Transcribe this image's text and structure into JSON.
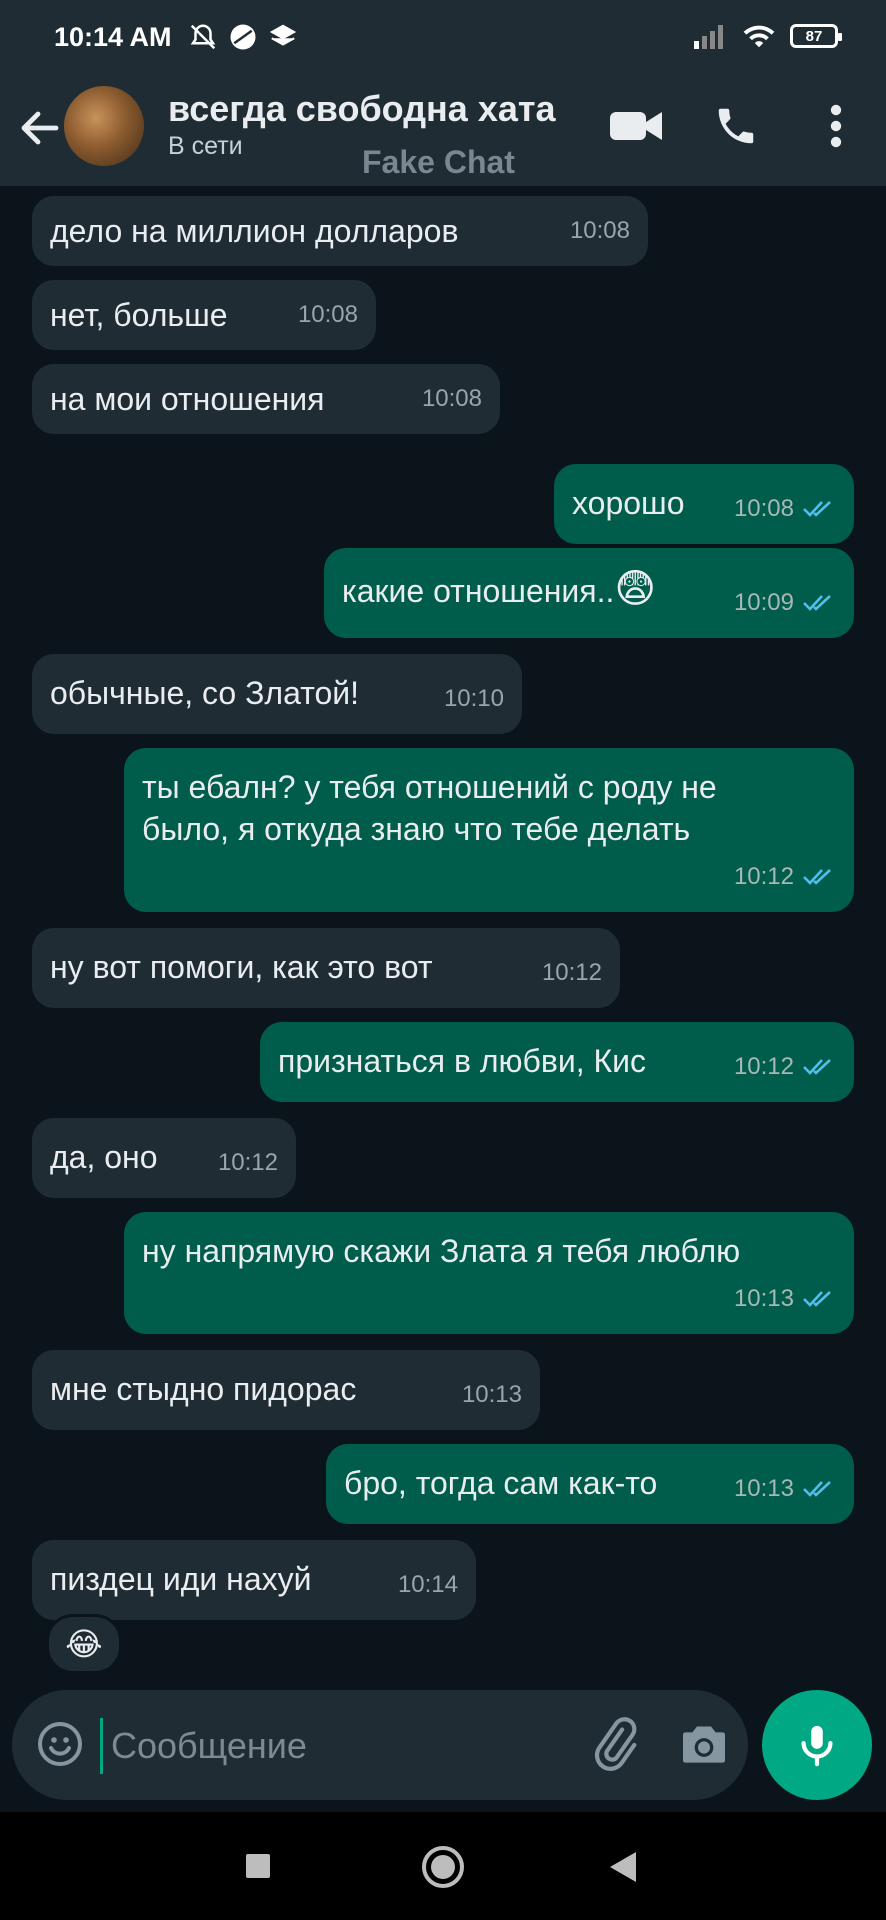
{
  "status_bar": {
    "time": "10:14 AM",
    "battery": "87"
  },
  "header": {
    "title": "всегда свободна хата",
    "status": "В сети",
    "watermark": "Fake Chat",
    "icons": [
      "back-arrow-icon",
      "avatar",
      "video-call-icon",
      "phone-icon",
      "more-vert-icon"
    ]
  },
  "messages": [
    {
      "dir": "in",
      "text": "дело на миллион долларов",
      "time": "10:08"
    },
    {
      "dir": "in",
      "text": "нет, больше",
      "time": "10:08"
    },
    {
      "dir": "in",
      "text": "на мои отношения",
      "time": "10:08"
    },
    {
      "dir": "out",
      "text": "хорошо",
      "time": "10:08",
      "status": "read"
    },
    {
      "dir": "out",
      "text": "какие отношения..",
      "emoji": "😨",
      "time": "10:09",
      "status": "read"
    },
    {
      "dir": "in",
      "text": "обычные, со Златой!",
      "time": "10:10"
    },
    {
      "dir": "out",
      "text": "ты ебалн? у тебя отношений с роду не\nбыло, я откуда знаю что тебе делать",
      "time": "10:12",
      "status": "read"
    },
    {
      "dir": "in",
      "text": "ну вот помоги, как это вот",
      "time": "10:12"
    },
    {
      "dir": "out",
      "text": "признаться в любви, Кис",
      "time": "10:12",
      "status": "read"
    },
    {
      "dir": "in",
      "text": "да, оно",
      "time": "10:12"
    },
    {
      "dir": "out",
      "text": "ну напрямую скажи Злата я тебя люблю",
      "time": "10:13",
      "status": "read"
    },
    {
      "dir": "in",
      "text": "мне стыдно пидорас",
      "time": "10:13"
    },
    {
      "dir": "out",
      "text": "бро, тогда сам как-то",
      "time": "10:13",
      "status": "read"
    },
    {
      "dir": "in",
      "text": "пиздец иди нахуй",
      "time": "10:14",
      "reaction": "😂"
    }
  ],
  "input": {
    "placeholder": "Сообщение"
  },
  "colors": {
    "incoming": "#202c33",
    "outgoing": "#005c4b",
    "accent": "#00a884",
    "read_ticks": "#53bdeb"
  }
}
